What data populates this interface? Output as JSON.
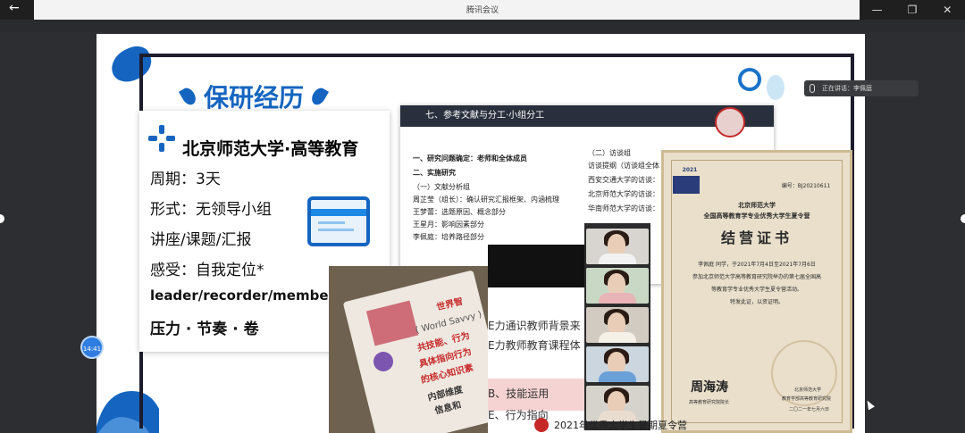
{
  "window": {
    "back_icon": "←",
    "title": "腾讯会议",
    "controls": [
      "—",
      "❐",
      "✕"
    ]
  },
  "slide": {
    "heading": "保研经历",
    "card": {
      "university": "北京师范大学·高等教育",
      "lines": [
        "周期：3天",
        "形式：无领导小组",
        "讲座/课题/汇报",
        "感受：自我定位*",
        "leader/recorder/member/",
        "压力 · 节奏 · 卷"
      ]
    },
    "doc": {
      "header": "七、参考文献与分工·小组分工",
      "left_lines": [
        {
          "text": "一、研究问题确定：老师和全体成员",
          "bold": true
        },
        {
          "text": "二、实施研究",
          "bold": true
        },
        {
          "text": "（一）文献分析组",
          "bold": false
        },
        {
          "text": "周芷莹（组长）：确认研究汇报框架、内涵梳理",
          "bold": false
        },
        {
          "text": "王梦蕾：选题原因、概念部分",
          "bold": false
        },
        {
          "text": "王星月：影响因素部分",
          "bold": false
        },
        {
          "text": "李佩庭：培养路径部分",
          "bold": false
        }
      ],
      "right_lines": [
        "（二）访谈组",
        "访谈提纲（访谈组全体",
        "西安交通大学的访谈：",
        "北京师范大学的访谈：",
        "华南师范大学的访谈："
      ]
    },
    "strip": {
      "line1": "E力通识教师背景来",
      "line2": "E力教师教育课程体",
      "line3": "B、技能运用",
      "line4": "E、行为指向"
    },
    "photo_words": [
      "世界智",
      "( World Savvy )",
      "共技能、行为",
      "具体指向行为",
      "的核心知识素",
      "内部维度",
      "信息和"
    ],
    "certificate": {
      "badge": "2021",
      "org": "北京师范大学",
      "sub": "全国高等教育学专业优秀大学生夏令营",
      "title": "结营证书",
      "serial": "编号：BJ20210611",
      "name_line": "李佩庭   同学，于2021年7月4日至2021年7月6日",
      "body1": "参加北京师范大学高等教育研究院举办的第七届全国高",
      "body2": "等教育学专业优秀大学生夏令营活动。",
      "body3": "特发此证，以资证明。",
      "signature": "周海涛",
      "sign_title": "高等教育研究院院长",
      "right_org1": "北京师范大学",
      "right_org2": "教育学部高等教育研究院",
      "date": "二〇二一年七月六日"
    },
    "bottom_caption": "2021年优秀大学生暑期夏令营"
  },
  "speaker": {
    "label": "正在讲话：李佩庭"
  },
  "timer": {
    "value": "14:41"
  },
  "colors": {
    "accent": "#1565c0",
    "chrome_dark": "#1f1f1f"
  },
  "icons": [
    "back-arrow-icon",
    "minimize-icon",
    "maximize-icon",
    "close-icon",
    "mic-icon",
    "plus-logo-icon",
    "browser-window-icon"
  ]
}
